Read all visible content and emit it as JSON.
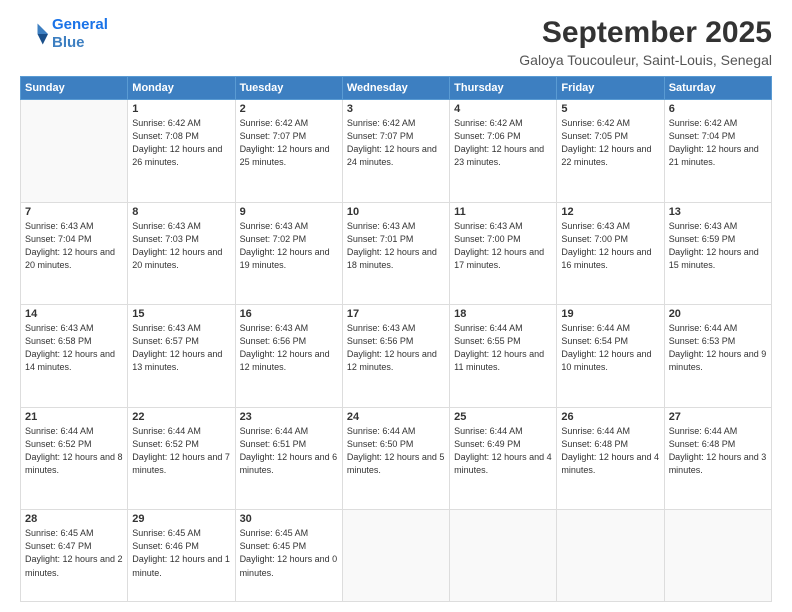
{
  "logo": {
    "line1": "General",
    "line2": "Blue"
  },
  "header": {
    "month": "September 2025",
    "location": "Galoya Toucouleur, Saint-Louis, Senegal"
  },
  "weekdays": [
    "Sunday",
    "Monday",
    "Tuesday",
    "Wednesday",
    "Thursday",
    "Friday",
    "Saturday"
  ],
  "days": [
    {
      "num": "",
      "empty": true
    },
    {
      "num": "1",
      "sunrise": "6:42 AM",
      "sunset": "7:08 PM",
      "daylight": "12 hours and 26 minutes."
    },
    {
      "num": "2",
      "sunrise": "6:42 AM",
      "sunset": "7:07 PM",
      "daylight": "12 hours and 25 minutes."
    },
    {
      "num": "3",
      "sunrise": "6:42 AM",
      "sunset": "7:07 PM",
      "daylight": "12 hours and 24 minutes."
    },
    {
      "num": "4",
      "sunrise": "6:42 AM",
      "sunset": "7:06 PM",
      "daylight": "12 hours and 23 minutes."
    },
    {
      "num": "5",
      "sunrise": "6:42 AM",
      "sunset": "7:05 PM",
      "daylight": "12 hours and 22 minutes."
    },
    {
      "num": "6",
      "sunrise": "6:42 AM",
      "sunset": "7:04 PM",
      "daylight": "12 hours and 21 minutes."
    },
    {
      "num": "7",
      "sunrise": "6:43 AM",
      "sunset": "7:04 PM",
      "daylight": "12 hours and 20 minutes."
    },
    {
      "num": "8",
      "sunrise": "6:43 AM",
      "sunset": "7:03 PM",
      "daylight": "12 hours and 20 minutes."
    },
    {
      "num": "9",
      "sunrise": "6:43 AM",
      "sunset": "7:02 PM",
      "daylight": "12 hours and 19 minutes."
    },
    {
      "num": "10",
      "sunrise": "6:43 AM",
      "sunset": "7:01 PM",
      "daylight": "12 hours and 18 minutes."
    },
    {
      "num": "11",
      "sunrise": "6:43 AM",
      "sunset": "7:00 PM",
      "daylight": "12 hours and 17 minutes."
    },
    {
      "num": "12",
      "sunrise": "6:43 AM",
      "sunset": "7:00 PM",
      "daylight": "12 hours and 16 minutes."
    },
    {
      "num": "13",
      "sunrise": "6:43 AM",
      "sunset": "6:59 PM",
      "daylight": "12 hours and 15 minutes."
    },
    {
      "num": "14",
      "sunrise": "6:43 AM",
      "sunset": "6:58 PM",
      "daylight": "12 hours and 14 minutes."
    },
    {
      "num": "15",
      "sunrise": "6:43 AM",
      "sunset": "6:57 PM",
      "daylight": "12 hours and 13 minutes."
    },
    {
      "num": "16",
      "sunrise": "6:43 AM",
      "sunset": "6:56 PM",
      "daylight": "12 hours and 12 minutes."
    },
    {
      "num": "17",
      "sunrise": "6:43 AM",
      "sunset": "6:56 PM",
      "daylight": "12 hours and 12 minutes."
    },
    {
      "num": "18",
      "sunrise": "6:44 AM",
      "sunset": "6:55 PM",
      "daylight": "12 hours and 11 minutes."
    },
    {
      "num": "19",
      "sunrise": "6:44 AM",
      "sunset": "6:54 PM",
      "daylight": "12 hours and 10 minutes."
    },
    {
      "num": "20",
      "sunrise": "6:44 AM",
      "sunset": "6:53 PM",
      "daylight": "12 hours and 9 minutes."
    },
    {
      "num": "21",
      "sunrise": "6:44 AM",
      "sunset": "6:52 PM",
      "daylight": "12 hours and 8 minutes."
    },
    {
      "num": "22",
      "sunrise": "6:44 AM",
      "sunset": "6:52 PM",
      "daylight": "12 hours and 7 minutes."
    },
    {
      "num": "23",
      "sunrise": "6:44 AM",
      "sunset": "6:51 PM",
      "daylight": "12 hours and 6 minutes."
    },
    {
      "num": "24",
      "sunrise": "6:44 AM",
      "sunset": "6:50 PM",
      "daylight": "12 hours and 5 minutes."
    },
    {
      "num": "25",
      "sunrise": "6:44 AM",
      "sunset": "6:49 PM",
      "daylight": "12 hours and 4 minutes."
    },
    {
      "num": "26",
      "sunrise": "6:44 AM",
      "sunset": "6:48 PM",
      "daylight": "12 hours and 4 minutes."
    },
    {
      "num": "27",
      "sunrise": "6:44 AM",
      "sunset": "6:48 PM",
      "daylight": "12 hours and 3 minutes."
    },
    {
      "num": "28",
      "sunrise": "6:45 AM",
      "sunset": "6:47 PM",
      "daylight": "12 hours and 2 minutes."
    },
    {
      "num": "29",
      "sunrise": "6:45 AM",
      "sunset": "6:46 PM",
      "daylight": "12 hours and 1 minute."
    },
    {
      "num": "30",
      "sunrise": "6:45 AM",
      "sunset": "6:45 PM",
      "daylight": "12 hours and 0 minutes."
    },
    {
      "num": "",
      "empty": true
    },
    {
      "num": "",
      "empty": true
    },
    {
      "num": "",
      "empty": true
    },
    {
      "num": "",
      "empty": true
    }
  ]
}
